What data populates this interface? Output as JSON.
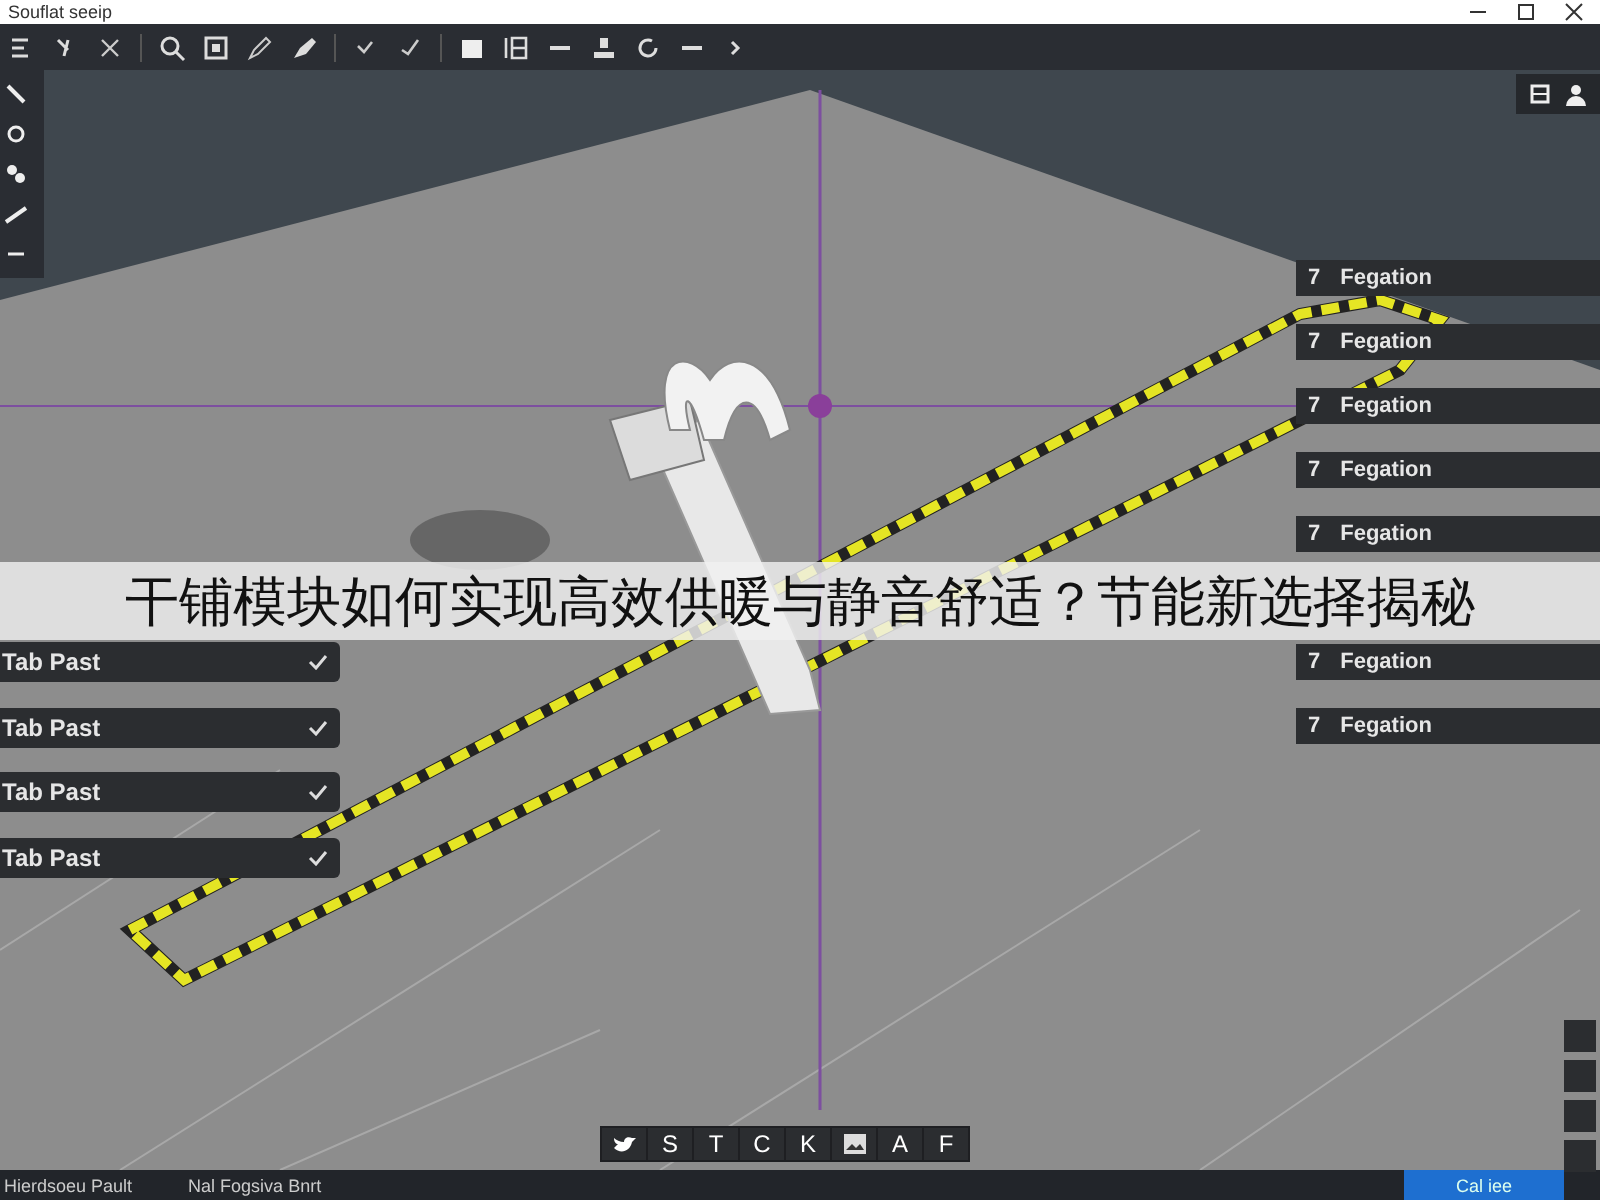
{
  "window": {
    "title": "Souflat seeip"
  },
  "layer_rows": [
    {
      "label": "Tab Past",
      "checked": true
    },
    {
      "label": "Tab Past",
      "checked": true
    },
    {
      "label": "Tab Past",
      "checked": true
    },
    {
      "label": "Tab Past",
      "checked": true
    }
  ],
  "property_rows": [
    {
      "number": "7",
      "label": "Fegation"
    },
    {
      "number": "7",
      "label": "Fegation"
    },
    {
      "number": "7",
      "label": "Fegation"
    },
    {
      "number": "7",
      "label": "Fegation"
    },
    {
      "number": "7",
      "label": "Fegation"
    },
    {
      "number": "7",
      "label": "Fegation"
    },
    {
      "number": "7",
      "label": "Fegation"
    }
  ],
  "bottom_toolbar": [
    {
      "kind": "bird"
    },
    {
      "kind": "letter",
      "text": "S"
    },
    {
      "kind": "letter",
      "text": "T"
    },
    {
      "kind": "letter",
      "text": "C"
    },
    {
      "kind": "letter",
      "text": "K"
    },
    {
      "kind": "image"
    },
    {
      "kind": "letter",
      "text": "A"
    },
    {
      "kind": "letter",
      "text": "F"
    }
  ],
  "banner": {
    "text": "干铺模块如何实现高效供暖与静音舒适？节能新选择揭秘"
  },
  "status_bar": {
    "items": [
      "Hierdsoeu Pault",
      "Nal Fogsiva Bnrt"
    ],
    "button": "Cal iee"
  }
}
